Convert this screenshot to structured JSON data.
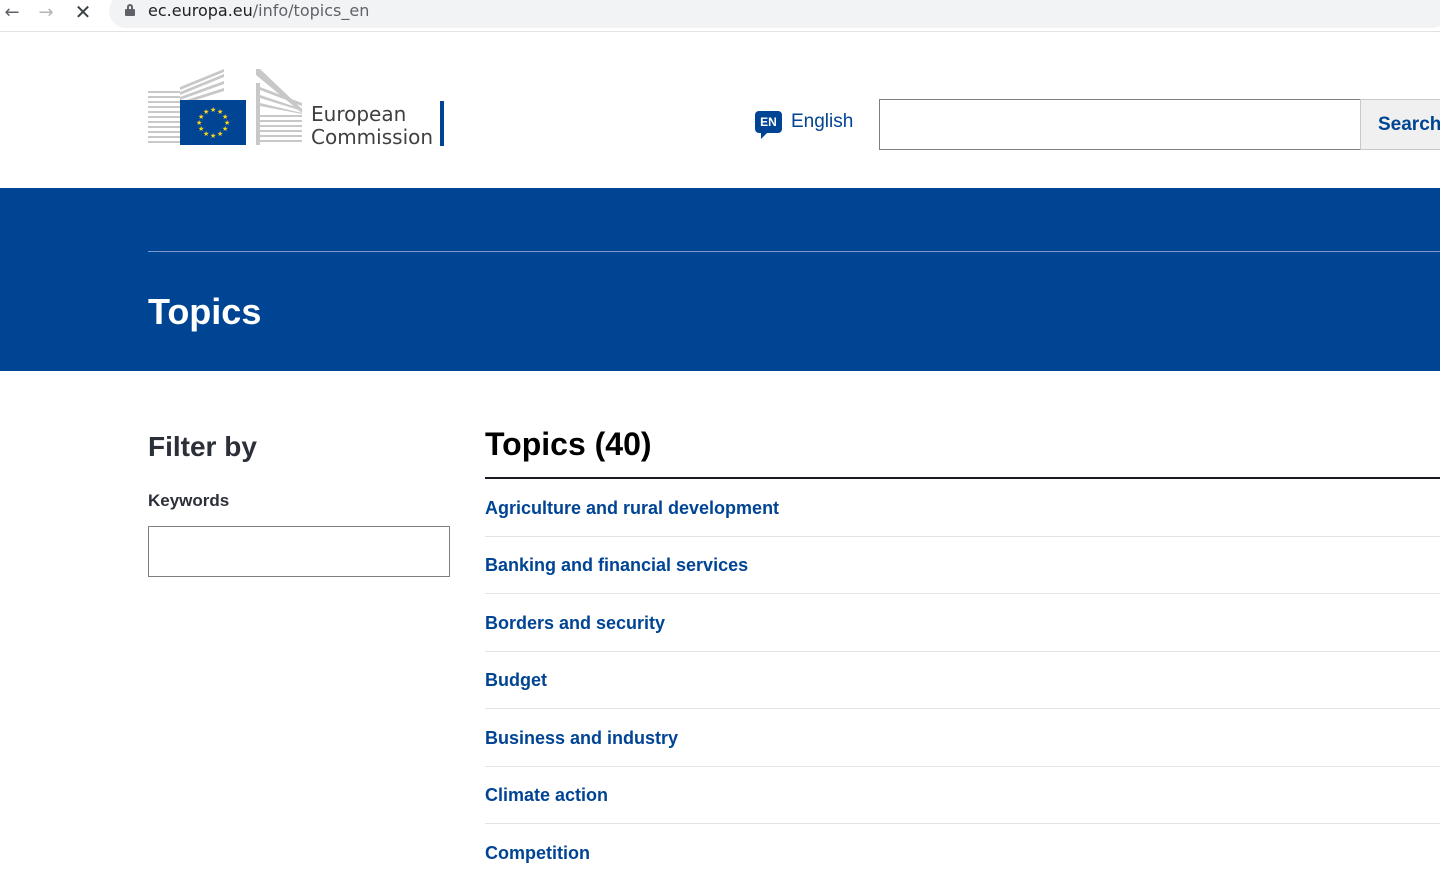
{
  "browser": {
    "url_host": "ec.europa.eu",
    "url_path": "/info/topics_en"
  },
  "header": {
    "logo_text_line1": "European",
    "logo_text_line2": "Commission",
    "language_code": "EN",
    "language_label": "English",
    "search_button_label": "Search",
    "search_value": ""
  },
  "banner": {
    "title": "Topics"
  },
  "filter": {
    "title": "Filter by",
    "keywords_label": "Keywords",
    "keywords_value": ""
  },
  "topics": {
    "title": "Topics (40)",
    "items": [
      {
        "label": "Agriculture and rural development"
      },
      {
        "label": "Banking and financial services"
      },
      {
        "label": "Borders and security"
      },
      {
        "label": "Budget"
      },
      {
        "label": "Business and industry"
      },
      {
        "label": "Climate action"
      },
      {
        "label": "Competition"
      }
    ]
  },
  "colors": {
    "brand_blue": "#004494",
    "eu_flag_yellow": "#ffd617"
  },
  "icons": {
    "back": "arrow-left-icon",
    "forward": "arrow-right-icon",
    "stop": "close-icon",
    "secure": "lock-icon",
    "language": "speech-bubble-icon"
  }
}
